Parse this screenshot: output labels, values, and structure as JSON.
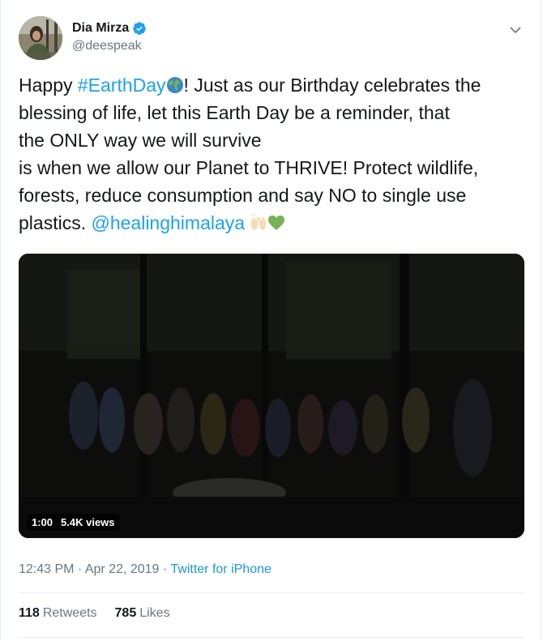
{
  "user": {
    "display_name": "Dia Mirza",
    "handle": "@deespeak",
    "verified": true
  },
  "tweet": {
    "line1_pre": "Happy ",
    "hashtag": "#EarthDay",
    "line1_post": "! Just as our Birthday celebrates the",
    "line2": "blessing of life, let this Earth Day be a reminder, that",
    "line3": "the ONLY way we will survive",
    "line4": "is when we allow our Planet to THRIVE! Protect wildlife,",
    "line5": "forests, reduce consumption and say NO to single use",
    "line6_pre": "plastics. ",
    "mention": "@healinghimalaya",
    "emoji_names": [
      "earth-globe-icon",
      "raising-hands-icon",
      "green-heart-icon"
    ]
  },
  "media": {
    "duration": "1:00",
    "views": "5.4K views"
  },
  "meta": {
    "time": "12:43 PM",
    "separator": " · ",
    "date": "Apr 22, 2019",
    "source": "Twitter for iPhone"
  },
  "stats": {
    "retweets_count": "118",
    "retweets_label": "Retweets",
    "likes_count": "785",
    "likes_label": "Likes"
  },
  "colors": {
    "link": "#1da1f2",
    "muted": "#657786",
    "text": "#14171a"
  }
}
